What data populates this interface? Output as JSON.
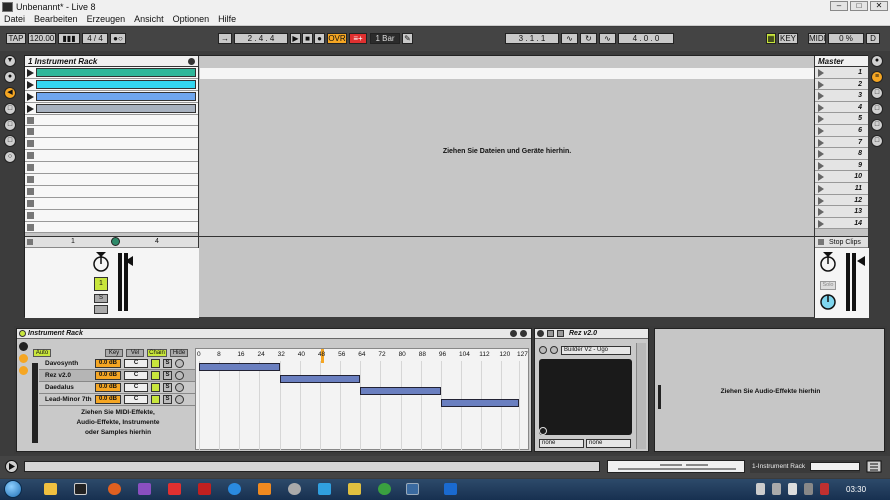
{
  "window": {
    "title": "Unbenannt* - Live 8",
    "buttons": [
      "–",
      "□",
      "✕"
    ]
  },
  "menu": [
    "Datei",
    "Bearbeiten",
    "Erzeugen",
    "Ansicht",
    "Optionen",
    "Hilfe"
  ],
  "transport": {
    "tap": "TAP",
    "tempo": "120.00",
    "signature": "4 / 4",
    "position": "2 . 4 . 4",
    "overdub": "OVR",
    "quantize": "1 Bar",
    "loop_start": "3 . 1 . 1",
    "loop_length": "4 . 0 . 0",
    "key": "KEY",
    "midi": "MIDI",
    "cpu": "0 %",
    "disk": "D"
  },
  "session": {
    "track_title": "1 Instrument Rack",
    "drop_message": "Ziehen Sie Dateien und Geräte hierhin.",
    "master_title": "Master",
    "scenes": [
      "1",
      "2",
      "3",
      "4",
      "5",
      "6",
      "7",
      "8",
      "9",
      "10",
      "11",
      "12",
      "13",
      "14"
    ],
    "track_number": "1",
    "track_send": "4",
    "arm_label": "1",
    "solo_label": "S",
    "stop_clips": "Stop Clips",
    "solo_cue": "Solo"
  },
  "colors": {
    "clip_teal": "#2fb79a",
    "clip_cyan": "#34d6f0",
    "clip_blue": "#6fa6ee",
    "clip_gray": "#a8b2c0",
    "accent_orange": "#f5a623",
    "accent_green": "#c8e63c"
  },
  "rack": {
    "title": "Instrument Rack",
    "auto": "Auto",
    "tabs": [
      "Key",
      "Vel",
      "Chain",
      "Hide"
    ],
    "ticks": [
      "0",
      "8",
      "16",
      "24",
      "32",
      "40",
      "48",
      "56",
      "64",
      "72",
      "80",
      "88",
      "96",
      "104",
      "112",
      "120",
      "127"
    ],
    "chains": [
      {
        "name": "Davosynth",
        "vol": "0.0 dB",
        "pan": "C",
        "solo": "S"
      },
      {
        "name": "Rez v2.0",
        "vol": "0.0 dB",
        "pan": "C",
        "solo": "S"
      },
      {
        "name": "Daedalus",
        "vol": "0.0 dB",
        "pan": "C",
        "solo": "S"
      },
      {
        "name": "Lead-Minor 7th",
        "vol": "0.0 dB",
        "pan": "C",
        "solo": "S"
      }
    ],
    "drop_message_1": "Ziehen Sie MIDI-Effekte,",
    "drop_message_2": "Audio-Effekte, Instrumente",
    "drop_message_3": "oder Samples hierhin"
  },
  "rez": {
    "title": "Rez v2.0",
    "preset": "Builder V2 - Ugo",
    "none_a": "none",
    "none_b": "none"
  },
  "fx": {
    "drop_message": "Ziehen Sie Audio-Effekte hierhin"
  },
  "status": {
    "rack_name": "1-Instrument Rack"
  },
  "taskbar": {
    "clock": "03:30"
  }
}
